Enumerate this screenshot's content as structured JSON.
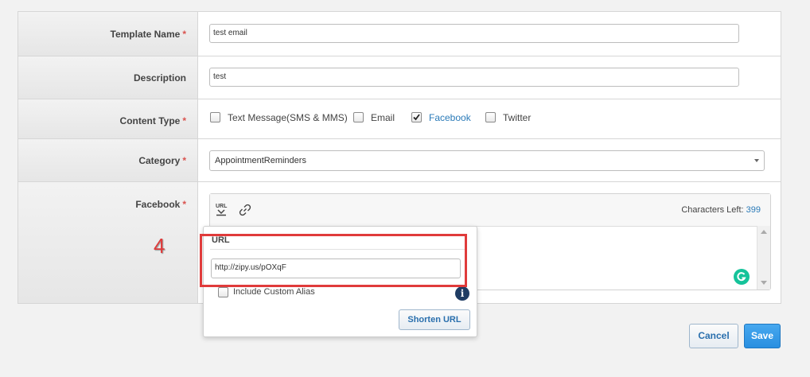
{
  "form": {
    "template_name_label": "Template Name",
    "template_name_value": "test email",
    "description_label": "Description",
    "description_value": "test",
    "content_type_label": "Content Type",
    "content_types": {
      "text": "Text Message(SMS & MMS)",
      "email": "Email",
      "facebook": "Facebook",
      "twitter": "Twitter"
    },
    "category_label": "Category",
    "category_value": "AppointmentReminders",
    "facebook_label": "Facebook",
    "required_marker": "*"
  },
  "editor": {
    "characters_left_label": "Characters Left:",
    "characters_left_value": "399"
  },
  "url_popup": {
    "title": "URL",
    "url_value": "http://zipy.us/pOXqF",
    "custom_alias_label": "Include Custom Alias",
    "shorten_button": "Shorten URL",
    "info_glyph": "i"
  },
  "annotation": {
    "step_number": "4",
    "color": "#e03b3b"
  },
  "actions": {
    "cancel_label": "Cancel",
    "save_label": "Save"
  },
  "colors": {
    "accent_blue": "#2a7ab8",
    "save_bg": "#2a8fe0",
    "required": "#d9534f",
    "grammarly": "#15c39a"
  },
  "icons": {
    "url_insert": "url-insert-icon",
    "link": "link-icon",
    "grammarly": "grammarly-icon",
    "info": "info-icon"
  }
}
